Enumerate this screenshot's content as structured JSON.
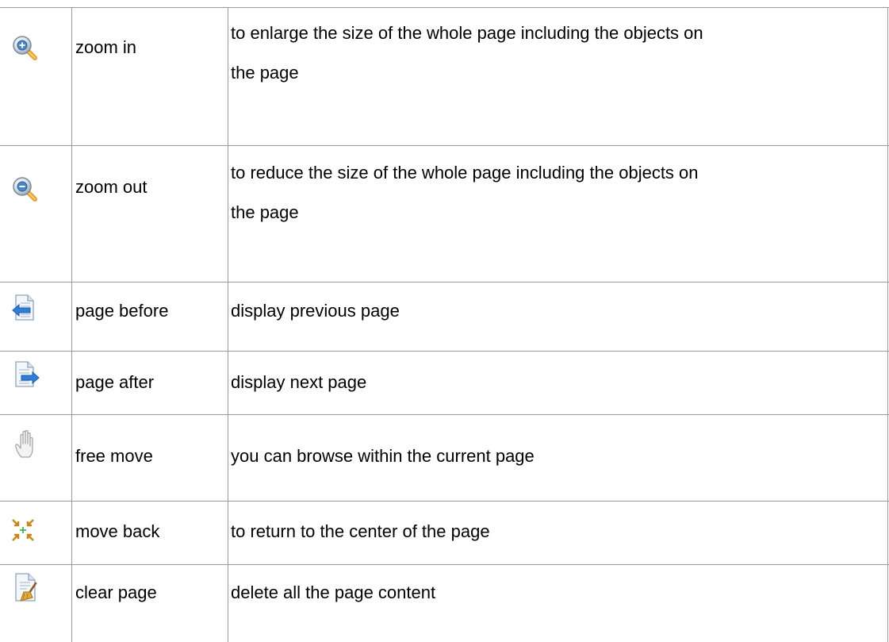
{
  "rows": [
    {
      "icon": "zoom-in-icon",
      "name": "zoom in",
      "description_line1": "to enlarge the size of the whole page including the objects on",
      "description_line2": "the page"
    },
    {
      "icon": "zoom-out-icon",
      "name": "zoom out",
      "description_line1": "to reduce the size of the whole page including the objects on",
      "description_line2": "the page"
    },
    {
      "icon": "page-before-icon",
      "name": "page before",
      "description": "display previous page"
    },
    {
      "icon": "page-after-icon",
      "name": "page after",
      "description": "display next page"
    },
    {
      "icon": "free-move-icon",
      "name": "free move",
      "description": "you can browse within the current page"
    },
    {
      "icon": "move-back-icon",
      "name": "move back",
      "description": "to return to the center of the page"
    },
    {
      "icon": "clear-page-icon",
      "name": "clear page",
      "description": "delete all the page content"
    }
  ],
  "colors": {
    "grid_line": "#9a9a9a",
    "zoom_lens": "#4a86c8",
    "zoom_handle": "#e4a035",
    "page_arrow": "#2f7ed8",
    "move_back_arrows": "#c8861f",
    "move_back_center": "#3aa845"
  }
}
